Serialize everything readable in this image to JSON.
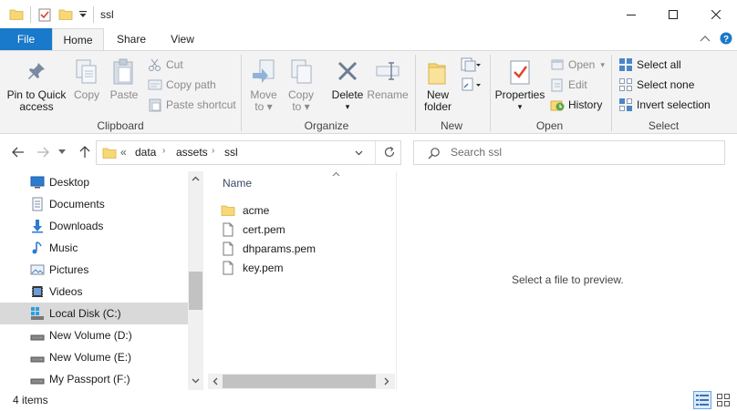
{
  "window": {
    "title": "ssl",
    "controls": [
      "minimize-icon",
      "maximize-icon",
      "close-icon"
    ]
  },
  "ribbon_tabs": [
    "File",
    "Home",
    "Share",
    "View"
  ],
  "ribbon": {
    "clipboard": {
      "pin_line1": "Pin to Quick",
      "pin_line2": "access",
      "copy": "Copy",
      "paste": "Paste",
      "cut": "Cut",
      "copy_path": "Copy path",
      "paste_shortcut": "Paste shortcut",
      "label": "Clipboard"
    },
    "organize": {
      "move_to_line1": "Move",
      "move_to_line2": "to",
      "copy_to_line1": "Copy",
      "copy_to_line2": "to",
      "delete": "Delete",
      "rename": "Rename",
      "label": "Organize"
    },
    "new": {
      "new_folder_line1": "New",
      "new_folder_line2": "folder",
      "label": "New"
    },
    "open": {
      "properties": "Properties",
      "open": "Open",
      "edit": "Edit",
      "history": "History",
      "label": "Open"
    },
    "select": {
      "select_all": "Select all",
      "select_none": "Select none",
      "invert_selection": "Invert selection",
      "label": "Select"
    }
  },
  "navigation": {
    "breadcrumb_prefix": "«",
    "breadcrumb": [
      "data",
      "assets",
      "ssl"
    ],
    "search_placeholder": "Search ssl"
  },
  "sidebar": {
    "items": [
      {
        "label": "Desktop",
        "icon": "desktop-icon"
      },
      {
        "label": "Documents",
        "icon": "documents-icon"
      },
      {
        "label": "Downloads",
        "icon": "downloads-icon"
      },
      {
        "label": "Music",
        "icon": "music-icon"
      },
      {
        "label": "Pictures",
        "icon": "pictures-icon"
      },
      {
        "label": "Videos",
        "icon": "videos-icon"
      },
      {
        "label": "Local Disk (C:)",
        "icon": "drive-icon",
        "selected": true
      },
      {
        "label": "New Volume (D:)",
        "icon": "drive-icon"
      },
      {
        "label": "New Volume (E:)",
        "icon": "drive-icon"
      },
      {
        "label": "My Passport (F:)",
        "icon": "drive-icon"
      }
    ]
  },
  "file_list": {
    "column_header": "Name",
    "items": [
      {
        "name": "acme",
        "type": "folder"
      },
      {
        "name": "cert.pem",
        "type": "file"
      },
      {
        "name": "dhparams.pem",
        "type": "file"
      },
      {
        "name": "key.pem",
        "type": "file"
      }
    ]
  },
  "preview": {
    "message": "Select a file to preview."
  },
  "status": {
    "item_count": "4 items"
  },
  "colors": {
    "file_tab": "#1979ca",
    "folder": "#f8d775",
    "selected_nav": "#d9d9d9"
  }
}
